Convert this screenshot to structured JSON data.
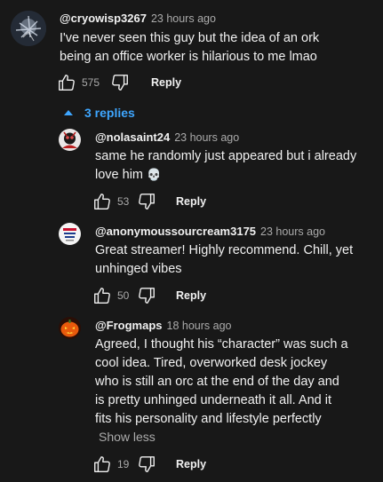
{
  "top_comment": {
    "author": "@cryowisp3267",
    "time": "23 hours ago",
    "text": "I've never seen this guy but the idea of an ork being an office worker is hilarious to me lmao",
    "likes": "575",
    "reply_label": "Reply"
  },
  "replies_toggle": {
    "label": "3 replies",
    "icon": "chevron-up-icon",
    "color": "#3ea6ff"
  },
  "replies": [
    {
      "author": "@nolasaint24",
      "time": "23 hours ago",
      "text": "same he randomly just appeared but i already love him",
      "emoji": "💀",
      "likes": "53",
      "reply_label": "Reply"
    },
    {
      "author": "@anonymoussourcream3175",
      "time": "23 hours ago",
      "text": "Great streamer! Highly recommend. Chill, yet unhinged vibes",
      "likes": "50",
      "reply_label": "Reply"
    },
    {
      "author": "@Frogmaps",
      "time": "18 hours ago",
      "text": "Agreed, I thought his “character” was such a cool idea. Tired, overworked desk jockey who is still an orc at the end of the day and is pretty unhinged underneath it all. And it fits his personality and lifestyle perfectly",
      "show_less_label": "Show less",
      "likes": "19",
      "reply_label": "Reply"
    }
  ],
  "colors": {
    "background": "#181818",
    "text": "#f1f1f1",
    "secondary": "#aaaaaa",
    "link": "#3ea6ff"
  }
}
